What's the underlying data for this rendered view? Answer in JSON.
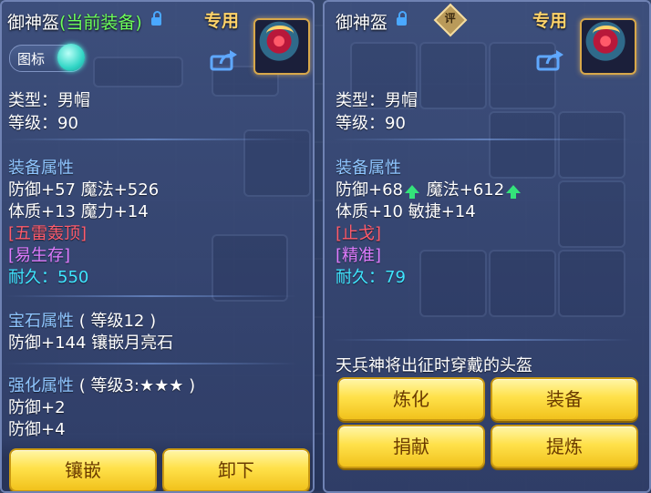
{
  "left": {
    "title_name": "御神盔",
    "title_status": "(当前装备)",
    "badge": "专用",
    "toggle_label": "图标",
    "type_line": "类型：男帽",
    "level_line": "等级：90",
    "equip_header": "装备属性",
    "attr1": "防御+57 魔法+526",
    "attr2": "体质+13 魔力+14",
    "special1": "[五雷轰顶]",
    "special2": "[易生存]",
    "durability_label": "耐久：",
    "durability_value": "550",
    "gem_header": "宝石属性",
    "gem_level": "( 等级12 )",
    "gem_line": "防御+144 镶嵌月亮石",
    "strengthen_header": "强化属性",
    "strengthen_level": "( 等级3:★★★ )",
    "str1": "防御+2",
    "str2": "防御+4",
    "btn_inlay": "镶嵌",
    "btn_unequip": "卸下"
  },
  "right": {
    "title_name": "御神盔",
    "rating": "评",
    "badge": "专用",
    "type_line": "类型：男帽",
    "level_line": "等级：90",
    "equip_header": "装备属性",
    "attr1a": "防御+68",
    "attr1b": "魔法+612",
    "attr2": "体质+10 敏捷+14",
    "special1": "[止戈]",
    "special2": "[精准]",
    "durability_label": "耐久：",
    "durability_value": "79",
    "description": "天兵神将出征时穿戴的头盔",
    "btn_refine": "炼化",
    "btn_equip": "装备",
    "btn_donate": "捐献",
    "btn_extract": "提炼"
  },
  "colors": {
    "accent_gold": "#ffd36a",
    "current_green": "#6cff5a",
    "section_blue": "#8fc6ff",
    "special_red": "#ff5b6b",
    "special_pink": "#e07cff",
    "durability_cyan": "#3fe6ff",
    "button_yellow": "#ffe14a"
  },
  "icons": {
    "lock": "lock-icon",
    "share": "share-icon",
    "helmet": "helmet-item-icon",
    "up_arrow": "up-arrow-icon",
    "rating": "rating-diamond-icon"
  }
}
